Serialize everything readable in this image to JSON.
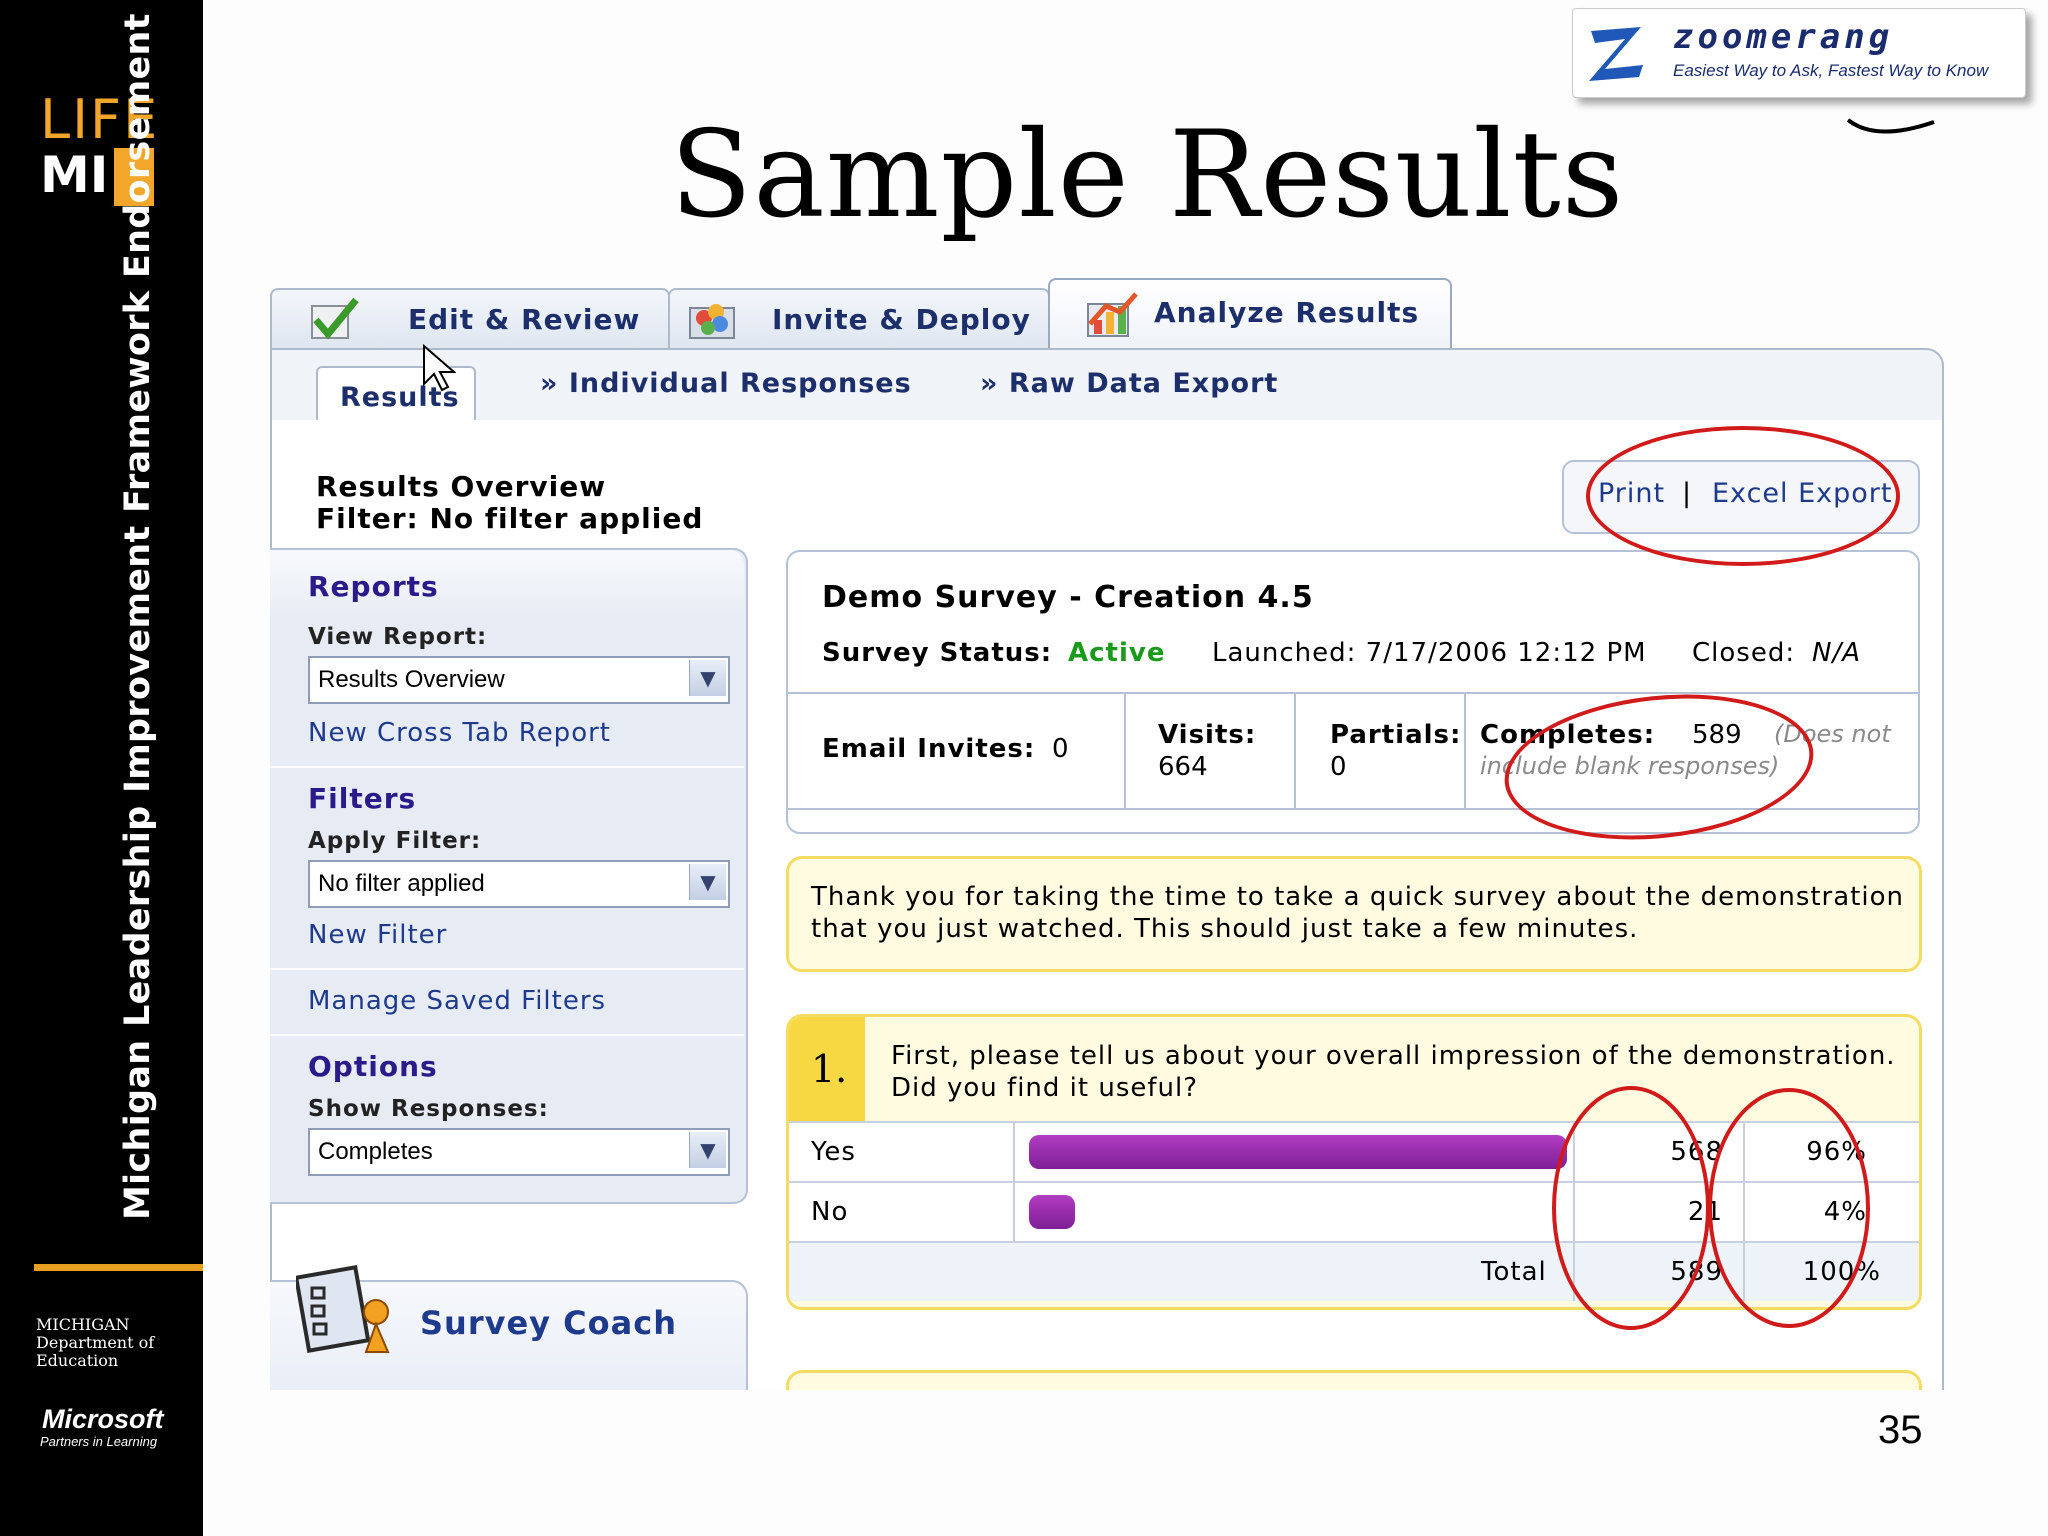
{
  "slide": {
    "title": "Sample Results",
    "page_number": "35",
    "side_title": "Michigan Leadership Improvement Framework Endorsement",
    "brand_top_life": "LIFE",
    "brand_top_mi": "MI",
    "brand_mde": "MICHIGAN Department of Education",
    "brand_ms": "Microsoft",
    "brand_ms_tag": "Partners in Learning"
  },
  "zoomerang": {
    "name": "zoomerang",
    "tagline": "Easiest Way to Ask, Fastest Way to Know"
  },
  "tabs": [
    {
      "label": "Edit & Review"
    },
    {
      "label": "Invite & Deploy"
    },
    {
      "label": "Analyze Results"
    }
  ],
  "subnav": {
    "results": "Results",
    "individual": "» Individual Responses",
    "raw": "» Raw Data Export"
  },
  "overview": {
    "title": "Results Overview",
    "filter": "Filter: No filter applied"
  },
  "actions": {
    "print": "Print",
    "sep": "|",
    "excel": "Excel Export"
  },
  "sidebar": {
    "reports_head": "Reports",
    "view_report_label": "View Report:",
    "view_report_value": "Results Overview",
    "cross_tab": "New Cross Tab Report",
    "filters_head": "Filters",
    "apply_filter_label": "Apply Filter:",
    "apply_filter_value": "No filter applied",
    "new_filter": "New Filter",
    "manage_filters": "Manage Saved Filters",
    "options_head": "Options",
    "show_responses_label": "Show Responses:",
    "show_responses_value": "Completes",
    "coach": "Survey Coach"
  },
  "survey": {
    "name": "Demo Survey - Creation 4.5",
    "status_label": "Survey Status:",
    "status_value": "Active",
    "launched": "Launched: 7/17/2006 12:12 PM",
    "closed_label": "Closed:",
    "closed_value": "N/A",
    "email_label": "Email Invites:",
    "email_value": "0",
    "visits_label": "Visits:",
    "visits_value": "664",
    "partials_label": "Partials:",
    "partials_value": "0",
    "completes_label": "Completes:",
    "completes_value": "589",
    "completes_note_1": "(Does not",
    "completes_note_2": "include blank responses)"
  },
  "message": {
    "line1": "Thank you for taking the time to take a quick survey about the demonstration",
    "line2": "that you just watched. This should just take a few minutes."
  },
  "question": {
    "number": "1.",
    "line1": "First, please tell us about your overall impression of the demonstration.",
    "line2": "Did you find it useful?",
    "rows": [
      {
        "label": "Yes",
        "count": "568",
        "pct": "96%",
        "share": 0.96
      },
      {
        "label": "No",
        "count": "21",
        "pct": "4%",
        "share": 0.04
      }
    ],
    "total_label": "Total",
    "total_count": "589",
    "total_pct": "100%"
  },
  "colors": {
    "accent_red": "#d11a1a",
    "bar": "#8e2aa6",
    "status_green": "#1a9a1a",
    "link": "#1e3a8c"
  }
}
